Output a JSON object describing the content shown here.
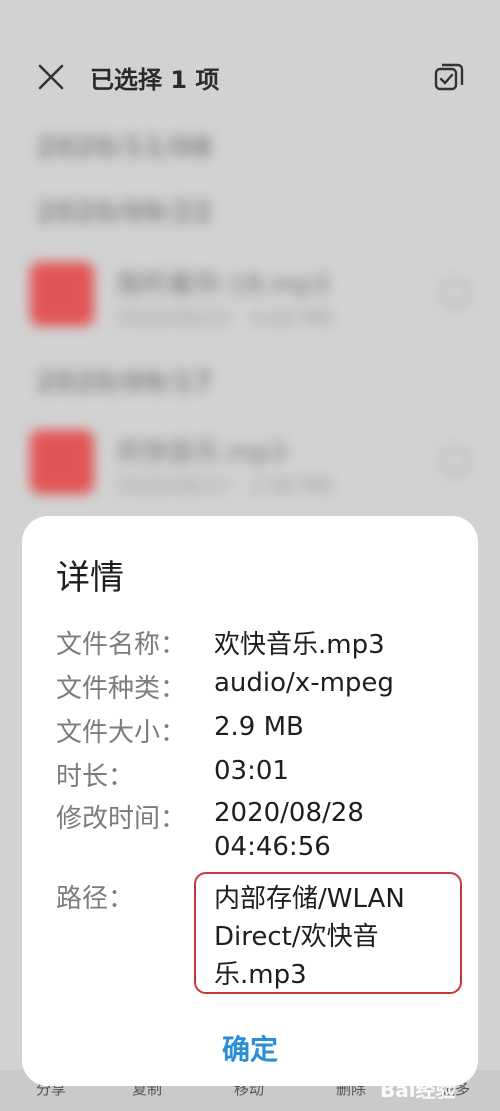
{
  "header": {
    "title": "已选择 1 项"
  },
  "background_list": {
    "dates": [
      "2020/11/08",
      "2020/09/22",
      "2020/09/17"
    ],
    "files": [
      {
        "name": "我听着你-18.mp3",
        "meta": "2020/09/22 · 4.60 MB"
      },
      {
        "name": "欢快音乐.mp3",
        "meta": "2020/08/17 · 2.90 MB"
      }
    ]
  },
  "bottom_bar": {
    "share": "分享",
    "copy": "复制",
    "move": "移动",
    "delete": "删除",
    "more": "更多"
  },
  "dialog": {
    "title": "详情",
    "rows": [
      {
        "label": "文件名称：",
        "value": "欢快音乐.mp3"
      },
      {
        "label": "文件种类：",
        "value": "audio/x-mpeg"
      },
      {
        "label": "文件大小：",
        "value": "2.9 MB"
      },
      {
        "label": "时长：",
        "value": "03:01"
      },
      {
        "label": "修改时间：",
        "value": "2020/08/28"
      },
      {
        "label": "",
        "value": "04:46:56"
      }
    ],
    "path_label": "路径：",
    "path_lines": [
      "内部存储/WLAN",
      "Direct/欢快音",
      "乐.mp3"
    ],
    "ok_label": "确定"
  },
  "watermark": "Bai经验",
  "colors": {
    "accent": "#2a8fd8",
    "highlight_border": "#c43a3a",
    "thumb": "#e25555"
  }
}
